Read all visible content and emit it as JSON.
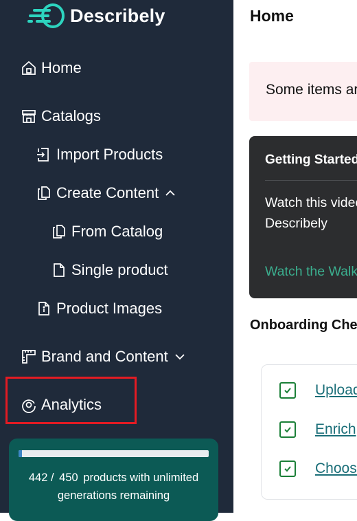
{
  "app": {
    "logo_text": "Describely",
    "brand_color": "#2dd4bf"
  },
  "sidebar": {
    "items": [
      {
        "label": "Home",
        "icon": "home-icon"
      },
      {
        "label": "Catalogs",
        "icon": "store-icon"
      },
      {
        "label": "Import Products",
        "icon": "import-icon"
      },
      {
        "label": "Create Content",
        "icon": "copy-icon",
        "expanded": true
      },
      {
        "label": "From Catalog",
        "icon": "copy-icon"
      },
      {
        "label": "Single product",
        "icon": "file-icon"
      },
      {
        "label": "Product Images",
        "icon": "file-info-icon"
      },
      {
        "label": "Brand and Content",
        "icon": "ruler-icon",
        "expanded": false
      },
      {
        "label": "Analytics",
        "icon": "analytics-icon",
        "highlighted": true
      }
    ],
    "credits": {
      "used": "442 /",
      "total": "450",
      "text_line1": "products with unlimited",
      "text_line2": "generations remaining",
      "progress_fraction": 0.018
    }
  },
  "main": {
    "title": "Home",
    "alert_text": "Some items are",
    "getting_started": {
      "title": "Getting Started",
      "body_line1": "Watch this video",
      "body_line2": "Describely",
      "link": "Watch the Walkthrough"
    },
    "onboarding_title": "Onboarding Checklist",
    "checklist": [
      {
        "label": "Upload",
        "checked": true
      },
      {
        "label": "Enrich",
        "checked": true
      },
      {
        "label": "Choose",
        "checked": true
      }
    ]
  },
  "colors": {
    "sidebar_bg": "#1f2a3a",
    "credits_bg": "#0c5a55",
    "highlight": "#e31b23",
    "check_green": "#1a7f37",
    "link_teal": "#3bae8e"
  }
}
